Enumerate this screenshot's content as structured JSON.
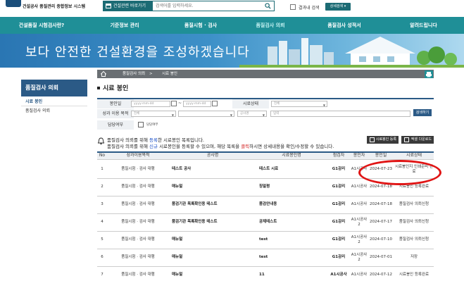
{
  "header": {
    "logo_text": "건설공사 품질관리 종합정보 시스템",
    "quick_label": "건설관련 바로가기",
    "search_placeholder": "검색어를 입력하세요.",
    "result_search_label": "결과내 검색",
    "detail_search_label": "상세검색"
  },
  "nav": {
    "items": [
      "건설품질 시험검사란?",
      "기준정보 관리",
      "품질시험 · 검사",
      "품질검사 의뢰",
      "품질검사 성적서",
      "알려드립니다"
    ]
  },
  "banner": {
    "slogan": "보다 안전한 건설환경을 조성하겠습니다"
  },
  "breadcrumb": {
    "items": [
      "품질검사 의뢰",
      "시료 봉인"
    ],
    "separator": ">"
  },
  "sidebar": {
    "title": "품질검사 의뢰",
    "items": [
      {
        "label": "시료 봉인",
        "active": true
      },
      {
        "label": "품질검사 의뢰",
        "active": false
      }
    ]
  },
  "page": {
    "title": "시료 봉인"
  },
  "filter": {
    "seal_date_label": "봉인일",
    "date_from_placeholder": "yyyy-mm-dd",
    "date_to_placeholder": "yyyy-mm-dd",
    "date_sep": "~",
    "sample_status_label": "시료상태",
    "sample_status_value": "전체",
    "purpose_label": "성과 이용 목적",
    "purpose_value": "전체",
    "purpose_sub_value": "",
    "type_value": "공사명",
    "keyword_placeholder": "입력",
    "search_button": "검색하기",
    "manager_label": "담당여부",
    "manager_checkbox_label": "담당여부"
  },
  "info": {
    "line1_parts": [
      "품질검사 의뢰를 위해 ",
      "등록",
      "한 시료봉인 목록입니다."
    ],
    "line2_parts": [
      "품질검사 의뢰를 위해 ",
      "신규",
      " 시료봉인을 등록할 수 있으며, 해당 목록을 ",
      "클릭",
      "하시면 상세내용을 확인/수정할 수 있습니다."
    ],
    "register_button": "시료봉인 등록",
    "excel_button": "엑셀 다운로드"
  },
  "table": {
    "headers": [
      "No",
      "성과이용목적",
      "공사명",
      "시료봉인명",
      "점검자",
      "봉인자",
      "봉인일",
      "시료상태"
    ],
    "rows": [
      {
        "no": "1",
        "purpose": "품질시험 · 검사 대행",
        "title": "테스트 공사",
        "sample": "테스트 시료",
        "grade": "G1감리",
        "sealer": "A1시공사",
        "date": "2024-07-23",
        "status": "시료봉인지 인쇄준비 완료"
      },
      {
        "no": "2",
        "purpose": "품질시험 · 검사 대행",
        "title": "매뉴얼",
        "sample": "칭얼펑",
        "grade": "G1감리",
        "sealer": "A1시공사",
        "date": "2024-07-18",
        "status": "시료봉인 등록완료"
      },
      {
        "no": "3",
        "purpose": "품질시험 · 검사 대행",
        "title": "품검기관 목록확인용 테스트",
        "sample": "품검안내용",
        "grade": "G1감리",
        "sealer": "A1시공사",
        "date": "2024-07-18",
        "status": "품질검사 의뢰신청"
      },
      {
        "no": "4",
        "purpose": "품질시험 · 검사 대행",
        "title": "품검기관 목록확인용 테스트",
        "sample": "공제테스트",
        "grade": "G1감리",
        "sealer": "A1시공사2",
        "date": "2024-07-17",
        "status": "품질검사 의뢰신청"
      },
      {
        "no": "5",
        "purpose": "품질시험 · 검사 대행",
        "title": "매뉴얼",
        "sample": "test",
        "grade": "G1감리",
        "sealer": "A1시공사2",
        "date": "2024-07-10",
        "status": "품질검사 의뢰신청"
      },
      {
        "no": "6",
        "purpose": "품질시험 · 검사 대행",
        "title": "매뉴얼",
        "sample": "test",
        "grade": "G1감리",
        "sealer": "A1시공사2",
        "date": "2024-07-01",
        "status": "저장"
      },
      {
        "no": "7",
        "purpose": "품질시험 · 검사 대행",
        "title": "매뉴얼",
        "sample": "11",
        "grade": "A1시공사",
        "sealer": "A1시공사",
        "date": "2024-07-12",
        "status": "시료봉인 등록완료"
      }
    ]
  },
  "colors": {
    "nav_teal": "#1f8f97",
    "sidebar_navy": "#2b5a86",
    "highlight_blue": "#1a4fc7",
    "highlight_red": "#d21c1c",
    "annotation_circle": "#e01414"
  }
}
